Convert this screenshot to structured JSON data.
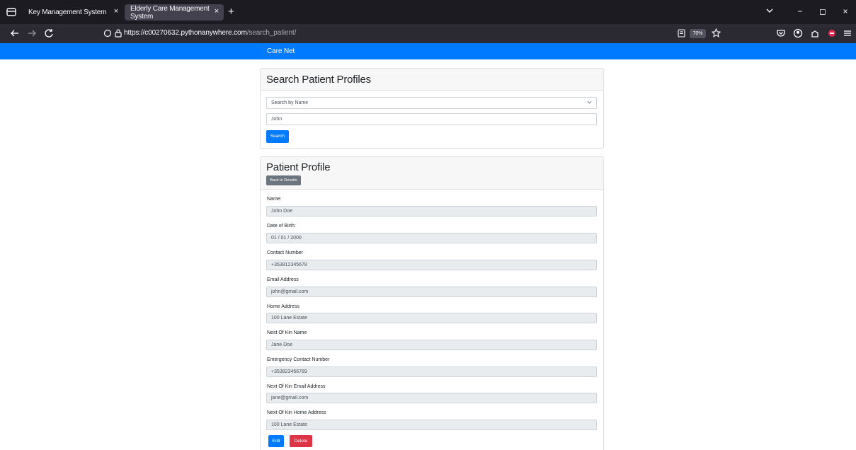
{
  "browser": {
    "tabs": [
      {
        "title": "Key Management System",
        "close": "×"
      },
      {
        "title": "Elderly Care Management System",
        "close": "×"
      }
    ],
    "new_tab": "+",
    "window_min": "−",
    "window_max": "◻",
    "window_close": "×",
    "url_host": "https://c00270632.pythonanywhere.com",
    "url_path": "/search_patient/",
    "zoom": "70%"
  },
  "navbar": {
    "brand": "Care Net"
  },
  "search": {
    "title": "Search Patient Profiles",
    "select_value": "Search by Name",
    "query": "John",
    "button": "Search"
  },
  "profile": {
    "title": "Patient Profile",
    "back_button": "Back to Results",
    "fields": [
      {
        "label": "Name:",
        "value": "John Doe"
      },
      {
        "label": "Date of Birth:",
        "value": "01 / 01 / 2000"
      },
      {
        "label": "Contact Number",
        "value": "+353812345678"
      },
      {
        "label": "Email Address",
        "value": "john@gmail.com"
      },
      {
        "label": "Home Address",
        "value": "100 Lane Estate"
      },
      {
        "label": "Nest Of Kin Name",
        "value": "Jane Doe"
      },
      {
        "label": "Emergency Contact Number",
        "value": "+353823456789"
      },
      {
        "label": "Next Of Kin Email Address",
        "value": "jane@gmail.com"
      },
      {
        "label": "Next Of Kin Home Address",
        "value": "100 Lane Estate"
      }
    ],
    "edit_button": "Edit",
    "delete_button": "Delete"
  },
  "colors": {
    "primary": "#007bff",
    "danger": "#dc3545",
    "secondary": "#6c757d",
    "readonly_bg": "#e9ecef"
  }
}
